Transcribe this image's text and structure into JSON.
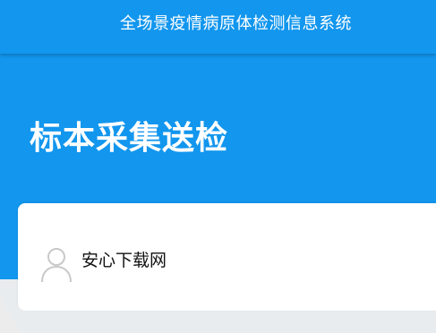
{
  "app": {
    "title": "全场景疫情病原体检测信息系统"
  },
  "page": {
    "title": "标本采集送检"
  },
  "user": {
    "name": "安心下载网",
    "avatar_icon": "user-avatar-icon"
  },
  "colors": {
    "primary": "#1296ee",
    "card_background": "#ffffff",
    "background": "#e9ecef"
  }
}
